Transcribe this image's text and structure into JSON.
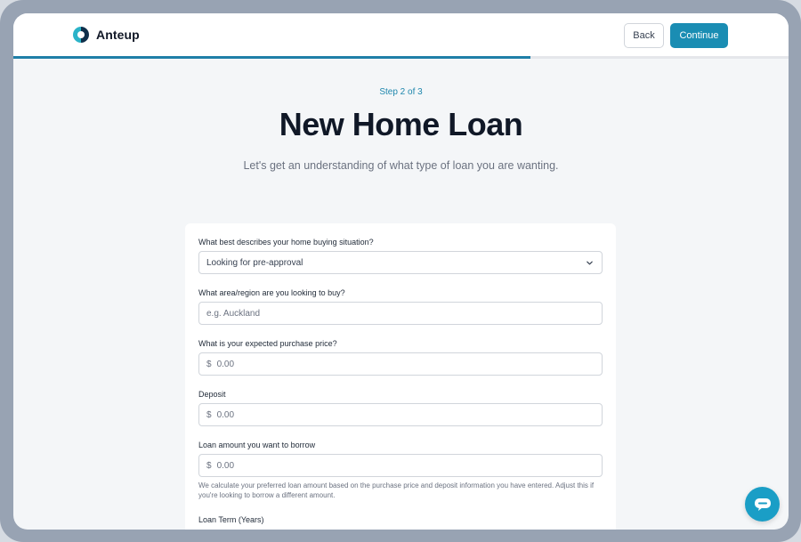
{
  "brand": {
    "name": "Anteup"
  },
  "header": {
    "back_label": "Back",
    "continue_label": "Continue"
  },
  "progress": {
    "fraction": 0.667
  },
  "step_text": "Step 2 of 3",
  "title": "New Home Loan",
  "subtitle": "Let's get an understanding of what type of loan you are wanting.",
  "form": {
    "situation": {
      "label": "What best describes your home buying situation?",
      "value": "Looking for pre-approval"
    },
    "region": {
      "label": "What area/region are you looking to buy?",
      "placeholder": "e.g. Auckland"
    },
    "price": {
      "label": "What is your expected purchase price?",
      "currency": "$",
      "value": "0.00"
    },
    "deposit": {
      "label": "Deposit",
      "currency": "$",
      "value": "0.00"
    },
    "loan_amount": {
      "label": "Loan amount you want to borrow",
      "currency": "$",
      "value": "0.00",
      "help": "We calculate your preferred loan amount based on the purchase price and deposit information you have entered. Adjust this if you're looking to borrow a different amount."
    },
    "loan_term": {
      "label": "Loan Term (Years)"
    }
  },
  "icons": {
    "chat": "chat-bubble-icon",
    "dropdown": "chevron-down-icon",
    "logo": "anteup-logo-icon"
  },
  "colors": {
    "accent": "#1a8db3",
    "chat": "#1a9ec6",
    "step": "#1f87ad"
  }
}
